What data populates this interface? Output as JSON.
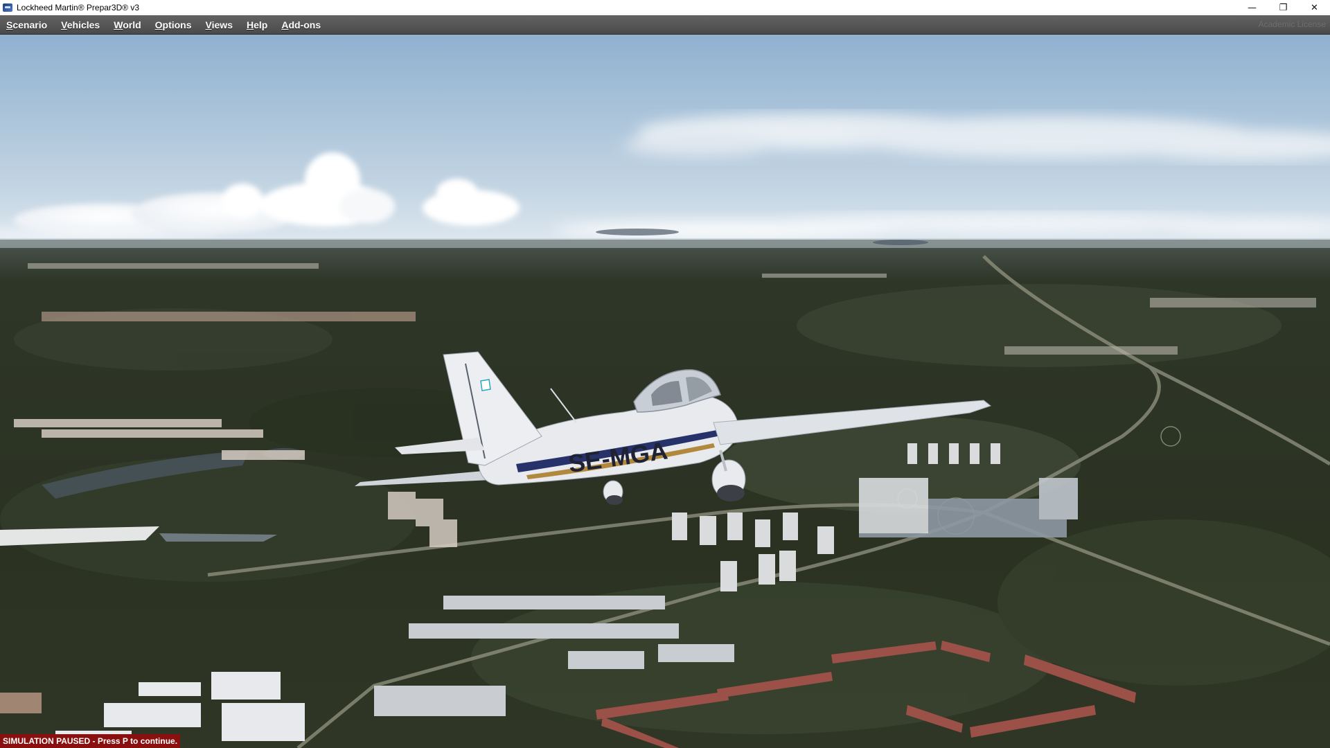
{
  "window": {
    "title": "Lockheed Martin® Prepar3D® v3",
    "controls": {
      "minimize": "—",
      "restore": "❐",
      "close": "✕"
    }
  },
  "menubar": {
    "items": [
      {
        "label": "Scenario",
        "mnemonic": "S",
        "rest": "cenario"
      },
      {
        "label": "Vehicles",
        "mnemonic": "V",
        "rest": "ehicles"
      },
      {
        "label": "World",
        "mnemonic": "W",
        "rest": "orld"
      },
      {
        "label": "Options",
        "mnemonic": "O",
        "rest": "ptions"
      },
      {
        "label": "Views",
        "mnemonic": "V",
        "rest": "iews"
      },
      {
        "label": "Help",
        "mnemonic": "H",
        "rest": "elp"
      },
      {
        "label": "Add-ons",
        "mnemonic": "A",
        "rest": "dd-ons"
      }
    ],
    "license_text": "Academic License"
  },
  "scene": {
    "aircraft_registration": "SE-MGA",
    "colors": {
      "sky_top": "#8fb1d0",
      "sky_horizon": "#e4ecf2",
      "terrain": "#2c3324",
      "aircraft_body": "#e8eaee",
      "aircraft_stripe": "#28326a"
    }
  },
  "status": {
    "pause_message": "SIMULATION PAUSED - Press P to continue."
  }
}
